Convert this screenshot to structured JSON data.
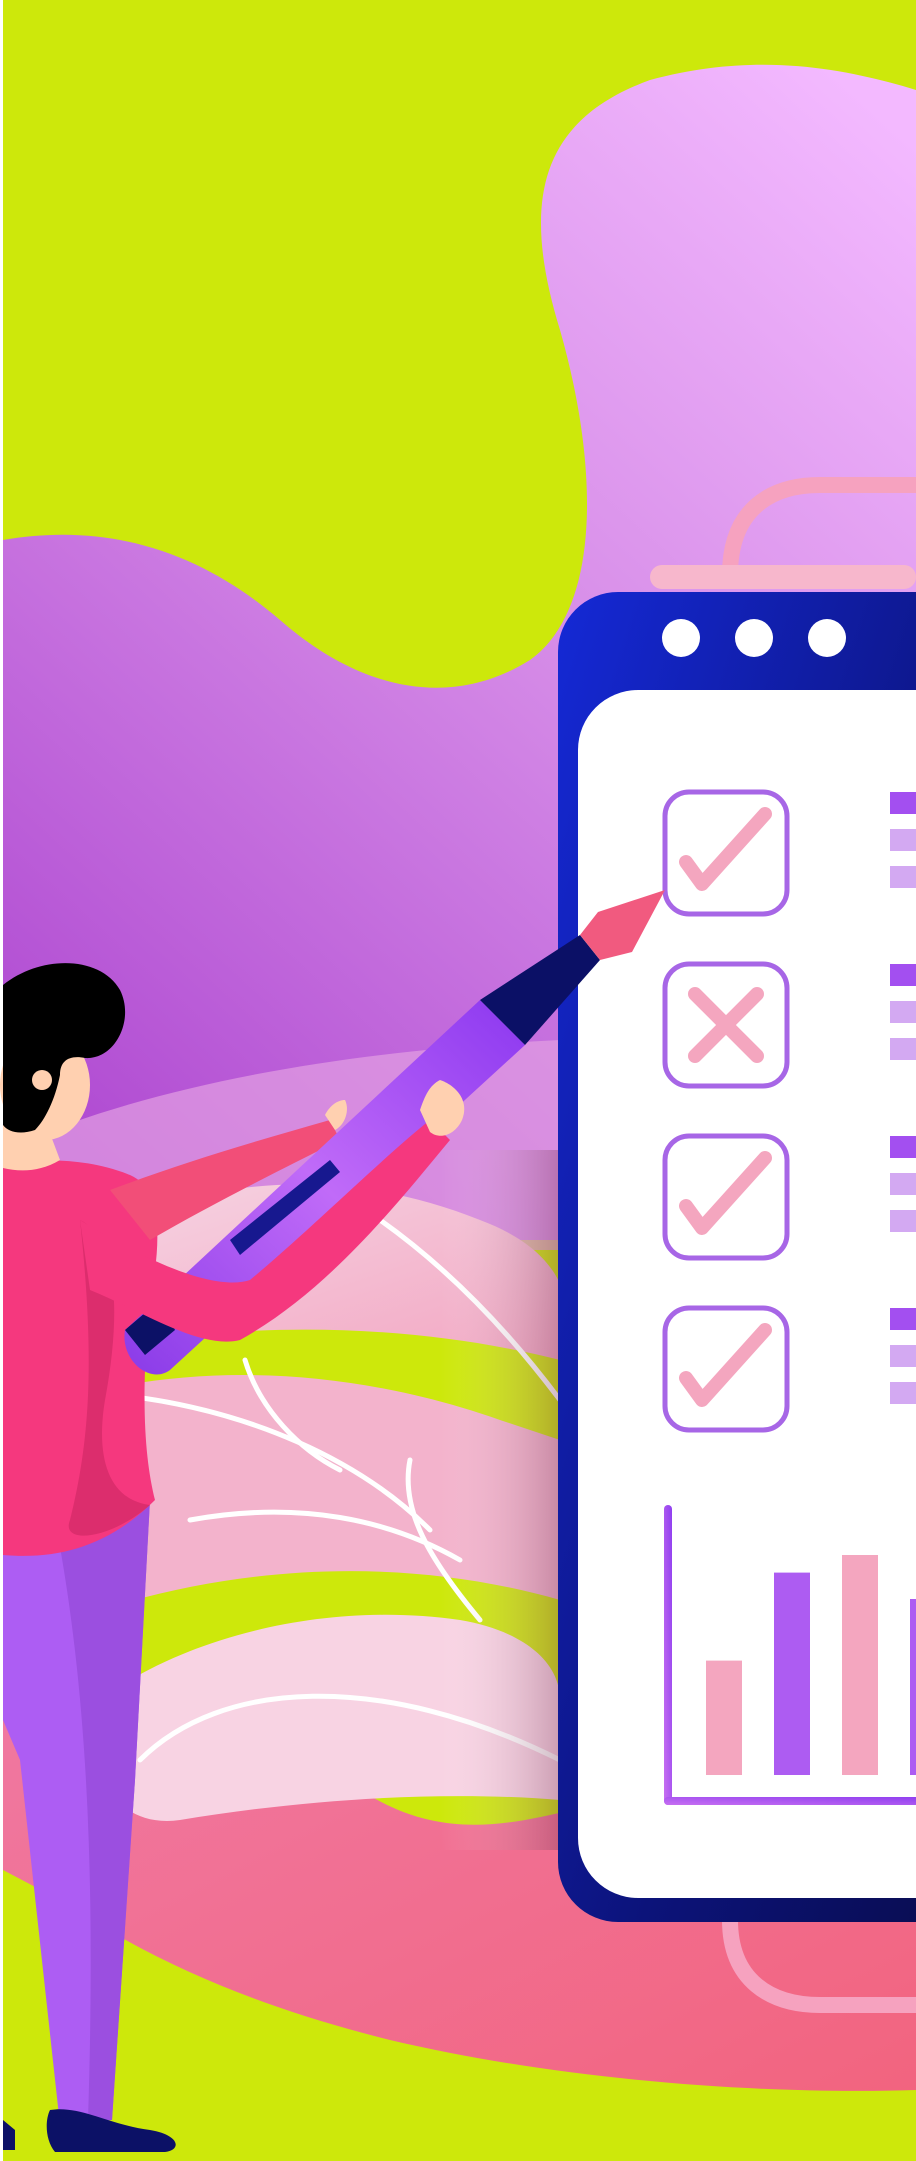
{
  "illustration": {
    "theme": "checklist-and-analytics",
    "background_color": "#cde80b",
    "accent_colors": {
      "purple_blob_top": "#eab3ff",
      "purple_blob_bottom": "#b34fd6",
      "pink_blob": "#f26a90",
      "window_frame": "#0f1fa8",
      "window_frame_dark": "#0b0f5a",
      "checkbox_border": "#a766e6",
      "check_mark": "#f4a6bf",
      "bar_purple": "#ad5cf2",
      "bar_pink": "#f4a6bf",
      "person_shirt": "#f5397f",
      "person_pants": "#ac5ff0",
      "person_hair": "#000000",
      "person_skin": "#ffd0b0",
      "pen": "#a04ff0"
    },
    "window": {
      "controls": [
        "dot",
        "dot",
        "dot"
      ],
      "checklist": [
        {
          "state": "checked",
          "icon": "check-icon",
          "lines": 3
        },
        {
          "state": "rejected",
          "icon": "cross-icon",
          "lines": 3
        },
        {
          "state": "checked",
          "icon": "check-icon",
          "lines": 3
        },
        {
          "state": "checked",
          "icon": "check-icon",
          "lines": 3
        }
      ],
      "bar_chart": {
        "bars": [
          {
            "color": "pink",
            "level": 0.52
          },
          {
            "color": "purple",
            "level": 0.92
          },
          {
            "color": "pink",
            "level": 1.0
          },
          {
            "color": "purple",
            "level": 0.8
          }
        ]
      }
    },
    "figure": "person-holding-pen"
  }
}
